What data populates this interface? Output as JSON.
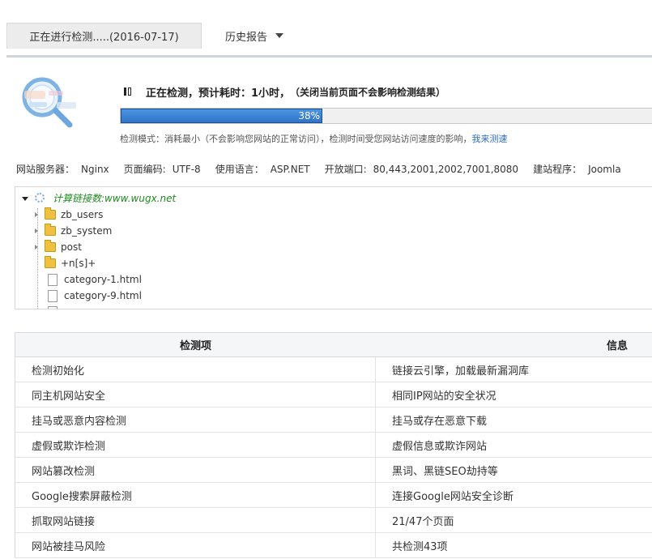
{
  "tabs": {
    "active_label": "正在进行检测.....(2016-07-17)",
    "history_label": "历史报告"
  },
  "status": {
    "title": "正在检测，预计耗时：1小时，",
    "subtitle": "（关闭当前页面不会影响检测结果）",
    "progress_label": "38%",
    "progress_value": 0.38
  },
  "mode": {
    "text": "检测模式：消耗最小（不会影响您网站的正常访问），检测时间受您网站访问速度的影响，",
    "link": "我来测速"
  },
  "server": [
    {
      "label": "网站服务器：",
      "value": "Nginx"
    },
    {
      "label": "页面编码:",
      "value": "UTF-8"
    },
    {
      "label": "使用语言：",
      "value": "ASP.NET"
    },
    {
      "label": "开放端口:",
      "value": "80,443,2001,2002,7001,8080"
    },
    {
      "label": "建站程序：",
      "value": "Joomla"
    }
  ],
  "tree": {
    "root": "计算链接数:www.wugx.net",
    "items": [
      {
        "name": "zb_users",
        "type": "folder"
      },
      {
        "name": "zb_system",
        "type": "folder"
      },
      {
        "name": "post",
        "type": "folder"
      },
      {
        "name": "+n[s]+",
        "type": "folder"
      },
      {
        "name": "category-1.html",
        "type": "file"
      },
      {
        "name": "category-9.html",
        "type": "file"
      }
    ]
  },
  "table": {
    "headers": [
      "检测项",
      "信息"
    ],
    "rows": [
      [
        "检测初始化",
        "链接云引擎，加载最新漏洞库"
      ],
      [
        "同主机网站安全",
        "相同IP网站的安全状况"
      ],
      [
        "挂马或恶意内容检测",
        "挂马或存在恶意下载"
      ],
      [
        "虚假或欺诈检测",
        "虚假信息或欺诈网站"
      ],
      [
        "网站篡改检测",
        "黑词、黑链SEO劫持等"
      ],
      [
        "Google搜索屏蔽检测",
        "连接Google网站安全诊断"
      ],
      [
        "抓取网站链接",
        "21/47个页面"
      ],
      [
        "网站被挂马风险",
        "共检测43项"
      ]
    ]
  },
  "colors": {
    "progress": "#2f74c8",
    "link": "#2f6cc0",
    "tree_root": "#1f8a1f"
  }
}
